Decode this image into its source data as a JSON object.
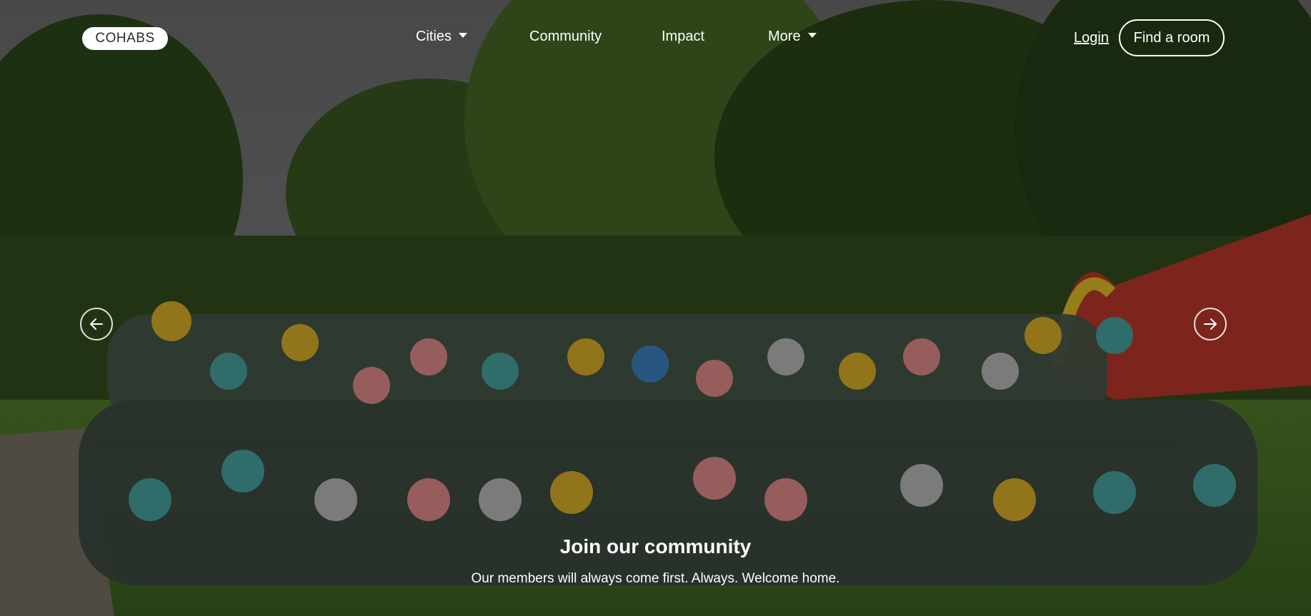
{
  "brand": {
    "logo_text": "COHABS"
  },
  "nav": {
    "items": [
      {
        "label": "Cities",
        "has_dropdown": true
      },
      {
        "label": "Community",
        "has_dropdown": false
      },
      {
        "label": "Impact",
        "has_dropdown": false
      },
      {
        "label": "More",
        "has_dropdown": true
      }
    ],
    "login_label": "Login",
    "cta_label": "Find a room"
  },
  "hero": {
    "title": "Join our community",
    "subtitle": "Our members will always come first. Always. Welcome home.",
    "prev_icon": "arrow-left-circle-icon",
    "next_icon": "arrow-right-circle-icon"
  },
  "colors": {
    "sky": "#7b7b7b",
    "foliage": "#3f5f25",
    "grass": "#5e8c35",
    "teal_shirt": "#4aa6a4",
    "yellow_shirt": "#e0b428",
    "pink_shirt": "#e88f8f"
  }
}
